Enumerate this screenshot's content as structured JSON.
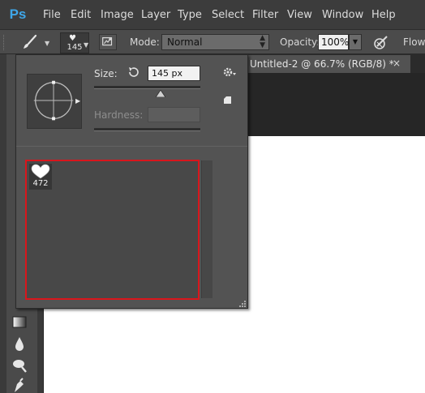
{
  "app": {
    "logo": "Ps"
  },
  "menu": [
    "File",
    "Edit",
    "Image",
    "Layer",
    "Type",
    "Select",
    "Filter",
    "View",
    "Window",
    "Help"
  ],
  "options": {
    "brush_size": "145",
    "mode_label": "Mode:",
    "mode_value": "Normal",
    "opacity_label": "Opacity:",
    "opacity_value": "100%",
    "flow_label": "Flow:"
  },
  "document_tab": {
    "title": "Untitled-2 @ 66.7% (RGB/8) *",
    "close": "×"
  },
  "brush_picker": {
    "size_label": "Size:",
    "size_value": "145 px",
    "size_slider_fraction": 0.6,
    "hardness_label": "Hardness:",
    "hardness_value": "",
    "presets": [
      {
        "icon": "heart-icon",
        "size": "472",
        "selected": true
      }
    ]
  },
  "colors": {
    "accent": "#3fa6e8",
    "selection": "#d9161c"
  }
}
